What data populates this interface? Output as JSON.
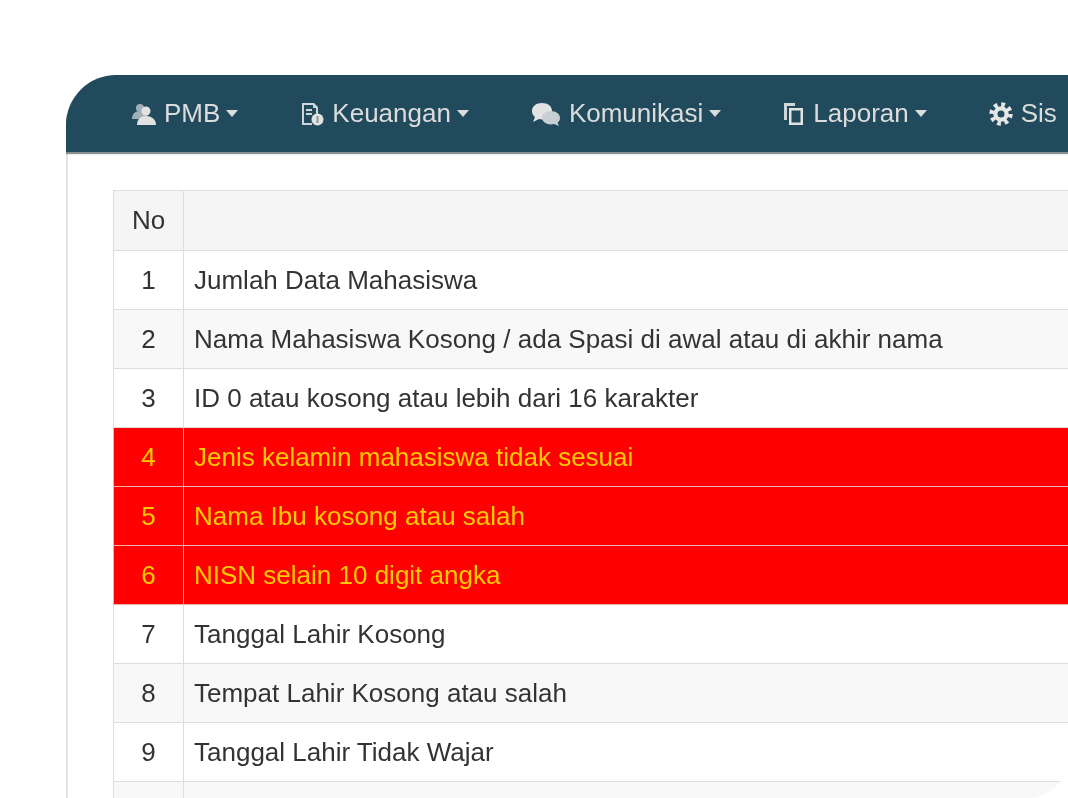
{
  "navbar": {
    "items": [
      {
        "label": "PMB",
        "dropdown": true
      },
      {
        "label": "Keuangan",
        "dropdown": true
      },
      {
        "label": "Komunikasi",
        "dropdown": true
      },
      {
        "label": "Laporan",
        "dropdown": true
      },
      {
        "label": "Sis",
        "dropdown": false
      }
    ]
  },
  "table": {
    "columns": [
      "No"
    ],
    "rows": [
      {
        "no": "1",
        "text": "Jumlah Data Mahasiswa",
        "highlighted": false
      },
      {
        "no": "2",
        "text": "Nama Mahasiswa Kosong / ada Spasi di awal atau di akhir nama",
        "highlighted": false
      },
      {
        "no": "3",
        "text": "ID 0 atau kosong atau lebih dari 16 karakter",
        "highlighted": false
      },
      {
        "no": "4",
        "text": "Jenis kelamin mahasiswa tidak sesuai",
        "highlighted": true
      },
      {
        "no": "5",
        "text": "Nama Ibu kosong atau salah",
        "highlighted": true
      },
      {
        "no": "6",
        "text": "NISN selain 10 digit angka",
        "highlighted": true
      },
      {
        "no": "7",
        "text": "Tanggal Lahir Kosong",
        "highlighted": false
      },
      {
        "no": "8",
        "text": "Tempat Lahir Kosong atau salah",
        "highlighted": false
      },
      {
        "no": "9",
        "text": "Tanggal Lahir Tidak Wajar",
        "highlighted": false
      },
      {
        "highlighted": false
      }
    ]
  }
}
